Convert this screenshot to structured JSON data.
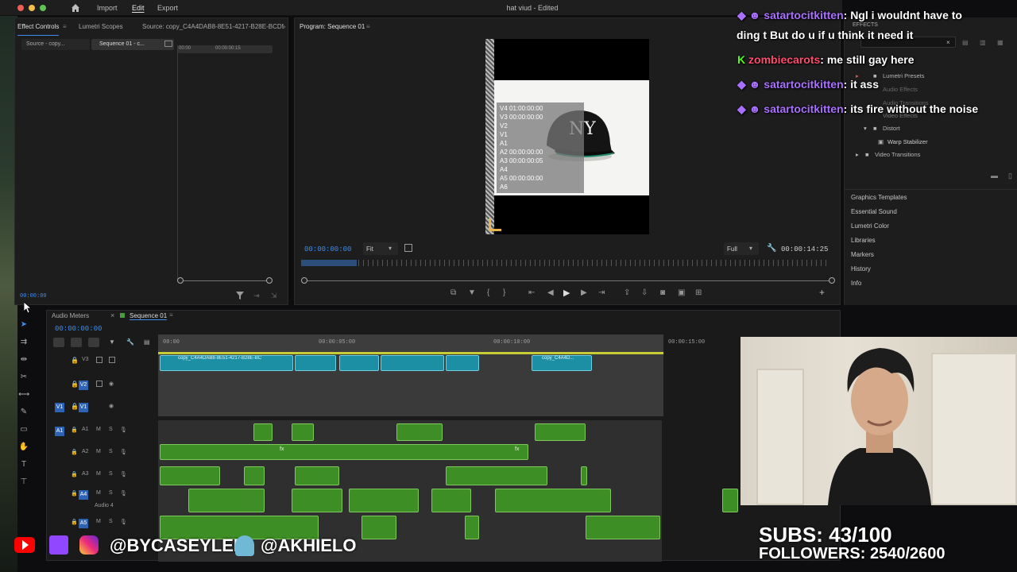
{
  "menubar": {
    "home_icon": "home-icon",
    "items": [
      "Import",
      "Edit",
      "Export"
    ],
    "document_title": "hat viud - Edited"
  },
  "source_panel": {
    "tabs": [
      "Effect Controls",
      "Lumetri Scopes",
      "Source: copy_C4A4DAB8-8E51-4217-B28E-BCD50E"
    ],
    "subtabs": [
      "Source - copy...",
      "Sequence 01 - c..."
    ],
    "mini_ruler": [
      "00:00",
      "00:00:00:15"
    ],
    "timecode": "00:00:00"
  },
  "program_panel": {
    "title": "Program: Sequence 01",
    "overlay_lines": [
      "V4 01:00:00:00",
      "V3 00:00:00:00",
      "V2",
      "V1",
      "A1",
      "A2 00:00:00:00",
      "A3 00:00:00:05",
      "A4",
      "A5 00:00:00:00",
      "A6"
    ],
    "timecode": "00:00:00:00",
    "fit_label": "Fit",
    "full_label": "Full",
    "duration": "00:00:14:25"
  },
  "effects_panel": {
    "header": "EFFECTS",
    "tree": [
      "Lumetri Presets",
      "Audio Effects",
      "Audio Transitions",
      "Video Effects",
      "Distort",
      "Warp Stabilizer",
      "Video Transitions"
    ],
    "side_links": [
      "Graphics Templates",
      "Essential Sound",
      "Lumetri Color",
      "Libraries",
      "Markers",
      "History",
      "Info"
    ]
  },
  "timeline": {
    "tabs": [
      "Audio Meters",
      "Sequence 01"
    ],
    "timecode": "00:00:00:00",
    "ruler": [
      "00:00",
      "00:00:05:00",
      "00:00:10:00",
      "00:00:15:00"
    ],
    "video_tracks": [
      {
        "id": "V3",
        "label": "V3"
      },
      {
        "id": "V2",
        "label": "V2"
      },
      {
        "id": "V1",
        "label": "V1"
      }
    ],
    "audio_tracks": [
      {
        "id": "A1",
        "label": "A1"
      },
      {
        "id": "A2",
        "label": "A2"
      },
      {
        "id": "A3",
        "label": "A3"
      },
      {
        "id": "A4",
        "label": "A4",
        "name": "Audio 4"
      },
      {
        "id": "A5",
        "label": "A5"
      }
    ],
    "clip_names": [
      "copy_C4A4DAB8-8E51-4217-B28E-BC",
      "copy_C4A4D..."
    ],
    "fx_mark": "fx"
  },
  "chat": [
    {
      "user": "satartocitkitten",
      "message": ": Ngl i wouldnt have to",
      "message2": "ding t But do u if u think it need it"
    },
    {
      "user": "zombiecarots",
      "message": ": me still gay here"
    },
    {
      "user": "satartocitkitten",
      "message": ": it ass"
    },
    {
      "user": "satartocitkitten",
      "message": ": its fire without the noise"
    }
  ],
  "stream_overlay": {
    "handle_1": "@BYCASEYLEE",
    "handle_2": "@AKHIELO",
    "subs": "SUBS: 43/100",
    "followers": "FOLLOWERS: 2540/2600"
  }
}
